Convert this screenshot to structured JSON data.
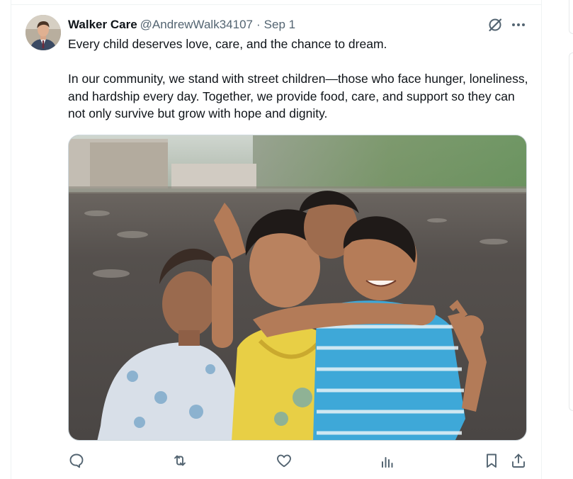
{
  "tweet": {
    "author_name": "Walker Care",
    "handle": "@AndrewWalk34107",
    "separator": "·",
    "date": "Sep 1",
    "text_paragraph_1": "Every child deserves love, care, and the chance to dream.",
    "text_paragraph_2": "In our community, we stand with street children—those who face hunger, loneliness, and hardship every day. Together, we provide food, care, and support so they can not only survive but grow with hope and dignity."
  },
  "icons": {
    "header": [
      "grok-icon",
      "more-icon"
    ],
    "actions": [
      "reply-icon",
      "repost-icon",
      "like-icon",
      "views-icon",
      "bookmark-icon",
      "share-icon"
    ]
  },
  "colors": {
    "text_primary": "#0f1419",
    "text_secondary": "#536471",
    "border": "#eff3f4"
  }
}
